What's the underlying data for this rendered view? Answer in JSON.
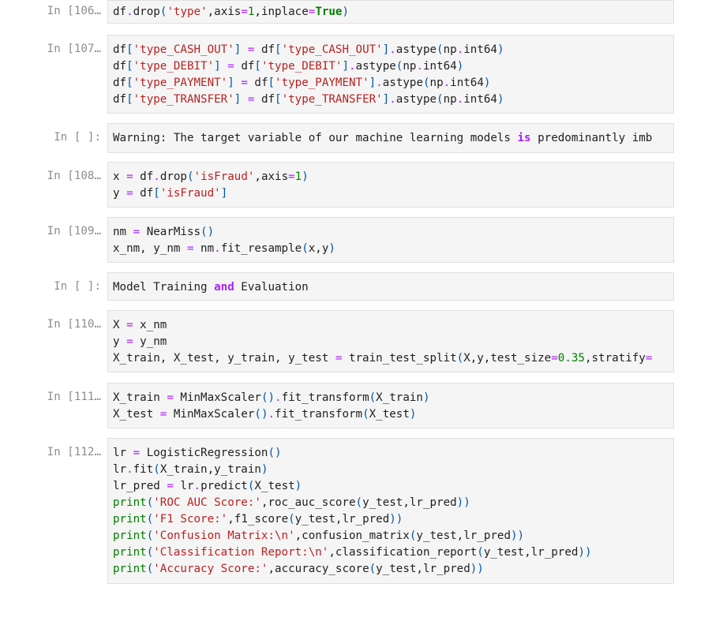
{
  "cells": [
    {
      "prompt": "In [106…",
      "lines": [
        "df.drop('type',axis=1,inplace=True)"
      ]
    },
    {
      "prompt": "In [107…",
      "lines": [
        "df['type_CASH_OUT'] = df['type_CASH_OUT'].astype(np.int64)",
        "df['type_DEBIT'] = df['type_DEBIT'].astype(np.int64)",
        "df['type_PAYMENT'] = df['type_PAYMENT'].astype(np.int64)",
        "df['type_TRANSFER'] = df['type_TRANSFER'].astype(np.int64)"
      ]
    },
    {
      "prompt": "In [ ]:",
      "lines": [
        "Warning: The target variable of our machine learning models is predominantly imb"
      ]
    },
    {
      "prompt": "In [108…",
      "lines": [
        "x = df.drop('isFraud',axis=1)",
        "y = df['isFraud']"
      ]
    },
    {
      "prompt": "In [109…",
      "lines": [
        "nm = NearMiss()",
        "x_nm, y_nm = nm.fit_resample(x,y)"
      ]
    },
    {
      "prompt": "In [ ]:",
      "lines": [
        "Model Training and Evaluation"
      ]
    },
    {
      "prompt": "In [110…",
      "lines": [
        "X = x_nm",
        "y = y_nm",
        "X_train, X_test, y_train, y_test = train_test_split(X,y,test_size=0.35,stratify="
      ]
    },
    {
      "prompt": "In [111…",
      "lines": [
        "X_train = MinMaxScaler().fit_transform(X_train)",
        "X_test = MinMaxScaler().fit_transform(X_test)"
      ]
    },
    {
      "prompt": "In [112…",
      "lines": [
        "lr = LogisticRegression()",
        "lr.fit(X_train,y_train)",
        "lr_pred = lr.predict(X_test)",
        "print('ROC AUC Score:',roc_auc_score(y_test,lr_pred))",
        "print('F1 Score:',f1_score(y_test,lr_pred))",
        "print('Confusion Matrix:\\n',confusion_matrix(y_test,lr_pred))",
        "print('Classification Report:\\n',classification_report(y_test,lr_pred))",
        "print('Accuracy Score:',accuracy_score(y_test,lr_pred))"
      ]
    }
  ],
  "syntax_colors": {
    "string": "#ba2121",
    "number": "#008000",
    "keyword": "#aa22ff",
    "builtin": "#008000",
    "prompt": "#8c8c8c"
  }
}
